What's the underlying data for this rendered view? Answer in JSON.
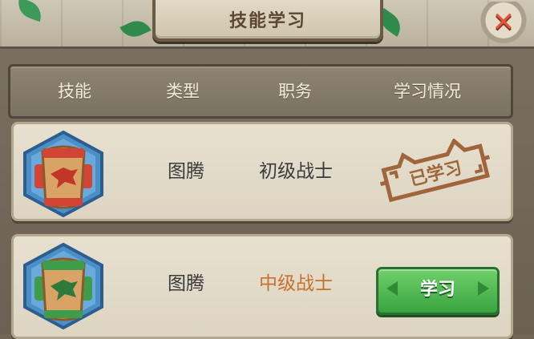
{
  "window": {
    "title": "技能学习",
    "close_icon": "close-icon"
  },
  "table": {
    "headers": [
      "技能",
      "类型",
      "职务",
      "学习情况"
    ],
    "rows": [
      {
        "skill_icon": "red-totem-icon",
        "type": "图腾",
        "job": "初级战士",
        "status_type": "stamp",
        "status": "已学习"
      },
      {
        "skill_icon": "green-totem-icon",
        "type": "图腾",
        "job": "中级战士",
        "status_type": "button",
        "status": "学习"
      }
    ]
  },
  "colors": {
    "job_highlight": "#c6722e",
    "learn_button": "#4cb447",
    "stamp": "#a0653a",
    "close": "#e0543a"
  }
}
